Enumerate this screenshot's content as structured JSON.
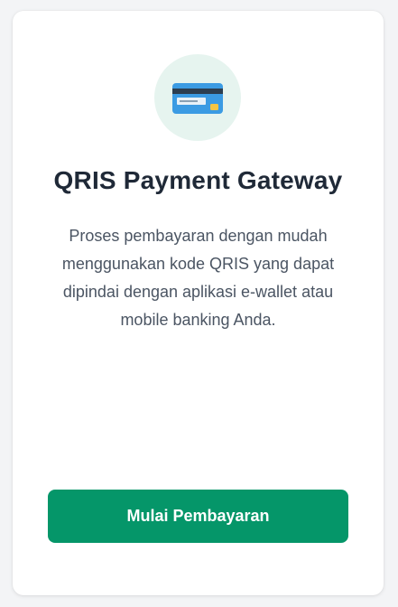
{
  "card": {
    "icon": "credit-card-icon",
    "title": "QRIS Payment Gateway",
    "description": "Proses pembayaran dengan mudah menggunakan kode QRIS yang dapat dipindai dengan aplikasi e-wallet atau mobile banking Anda.",
    "button_label": "Mulai Pembayaran"
  },
  "colors": {
    "accent": "#059669",
    "icon_bg": "#e6f4ef",
    "card_blue": "#3b9be3",
    "chip_yellow": "#f5c542"
  }
}
